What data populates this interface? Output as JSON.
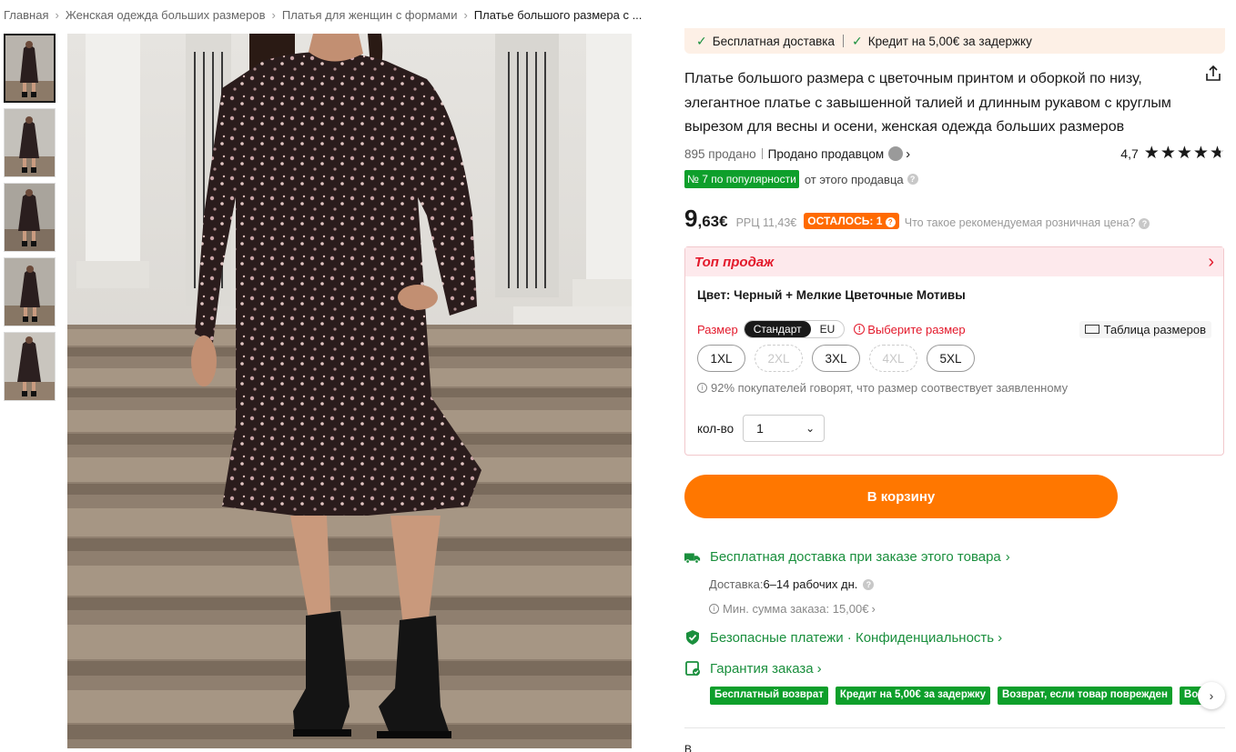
{
  "breadcrumb": [
    "Главная",
    "Женская одежда больших размеров",
    "Платья для женщин с формами",
    "Платье большого размера с ..."
  ],
  "thumbnails": [
    "thumb-1",
    "thumb-2",
    "thumb-3",
    "thumb-4",
    "thumb-5"
  ],
  "promo": {
    "free_shipping": "Бесплатная доставка",
    "credit": "Кредит на 5,00€ за задержку"
  },
  "product": {
    "title": "Платье большого размера с цветочным принтом и оборкой по низу, элегантное платье с завышенной талией и длинным рукавом с круглым вырезом для весны и осени, женская одежда больших размеров",
    "sold": "895 продано",
    "seller": "Продано продавцом",
    "rating": "4,7",
    "rank_badge": "№ 7 по популярности",
    "rank_text": "от этого продавца",
    "price_int": "9",
    "price_dec": ",63€",
    "rrp": "РРЦ 11,43€",
    "left_badge": "ОСТАЛОСЬ: 1",
    "rrp_question": "Что такое рекомендуемая розничная цена?"
  },
  "sku": {
    "header": "Топ продаж",
    "color": "Цвет: Черный + Мелкие Цветочные Мотивы",
    "size_label": "Размер",
    "size_systems": [
      "Стандарт",
      "EU"
    ],
    "size_warning": "Выберите размер",
    "size_table": "Таблица размеров",
    "sizes": [
      {
        "label": "1XL",
        "available": true
      },
      {
        "label": "2XL",
        "available": false
      },
      {
        "label": "3XL",
        "available": true
      },
      {
        "label": "4XL",
        "available": false
      },
      {
        "label": "5XL",
        "available": true
      }
    ],
    "fit_note": "92% покупателей говорят, что размер соотвествует заявленному",
    "qty_label": "кол-во",
    "qty_value": "1"
  },
  "cart_button": "В корзину",
  "shipping": {
    "title": "Бесплатная доставка при заказе этого товара",
    "delivery_label": "Доставка:",
    "delivery_value": "6–14 рабочих дн.",
    "min_order": "Мин. сумма заказа: 15,00€"
  },
  "security": {
    "title": "Безопасные платежи · Конфиденциальность"
  },
  "guarantee": {
    "title": "Гарантия заказа",
    "tags": [
      "Бесплатный возврат",
      "Кредит на 5,00€ за задержку",
      "Возврат, если товар поврежден",
      "Воз"
    ]
  },
  "bottom_text": "В",
  "colors": {
    "accent": "#ff7700",
    "green": "#1a8f3d",
    "red": "#e3192b",
    "promo_bg": "#fdf0e6"
  }
}
